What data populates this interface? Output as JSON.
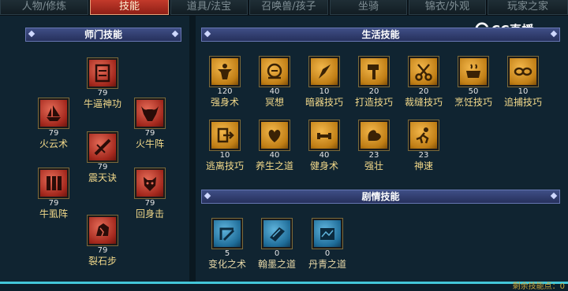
{
  "tabs": [
    {
      "label": "人物/修炼",
      "active": false
    },
    {
      "label": "技能",
      "active": true
    },
    {
      "label": "道具/法宝",
      "active": false
    },
    {
      "label": "召唤兽/孩子",
      "active": false
    },
    {
      "label": "坐骑",
      "active": false
    },
    {
      "label": "锦衣/外观",
      "active": false
    },
    {
      "label": "玩家之家",
      "active": false
    }
  ],
  "logo": {
    "text": "CC直播"
  },
  "school": {
    "title": "师门技能",
    "skills": [
      {
        "name": "牛逼神功",
        "level": "79",
        "icon": "mask-icon"
      },
      {
        "name": "火云术",
        "level": "79",
        "icon": "ship-icon"
      },
      {
        "name": "火牛阵",
        "level": "79",
        "icon": "bull-icon"
      },
      {
        "name": "震天诀",
        "level": "79",
        "icon": "slash-icon"
      },
      {
        "name": "牛虱阵",
        "level": "79",
        "icon": "bars-icon"
      },
      {
        "name": "回身击",
        "level": "79",
        "icon": "demon-icon"
      },
      {
        "name": "裂石步",
        "level": "79",
        "icon": "rock-icon"
      }
    ]
  },
  "life": {
    "title": "生活技能",
    "skills": [
      {
        "name": "强身术",
        "level": "120",
        "icon": "strong-body-icon"
      },
      {
        "name": "冥想",
        "level": "40",
        "icon": "meditate-icon"
      },
      {
        "name": "暗器技巧",
        "level": "10",
        "icon": "dart-icon"
      },
      {
        "name": "打造技巧",
        "level": "20",
        "icon": "hammer-icon"
      },
      {
        "name": "裁缝技巧",
        "level": "20",
        "icon": "scissors-icon"
      },
      {
        "name": "烹饪技巧",
        "level": "50",
        "icon": "cooking-icon"
      },
      {
        "name": "追捕技巧",
        "level": "10",
        "icon": "chain-icon"
      },
      {
        "name": "逃离技巧",
        "level": "10",
        "icon": "escape-icon"
      },
      {
        "name": "养生之道",
        "level": "40",
        "icon": "health-icon"
      },
      {
        "name": "健身术",
        "level": "40",
        "icon": "fitness-icon"
      },
      {
        "name": "强壮",
        "level": "23",
        "icon": "muscle-icon"
      },
      {
        "name": "神速",
        "level": "23",
        "icon": "speed-icon"
      }
    ]
  },
  "plot": {
    "title": "剧情技能",
    "skills": [
      {
        "name": "变化之术",
        "level": "5",
        "icon": "transform-icon"
      },
      {
        "name": "翰墨之道",
        "level": "0",
        "icon": "ink-icon"
      },
      {
        "name": "丹青之道",
        "level": "0",
        "icon": "scroll-icon"
      }
    ]
  },
  "footer": {
    "remaining_label": "剩余技能点：0"
  }
}
